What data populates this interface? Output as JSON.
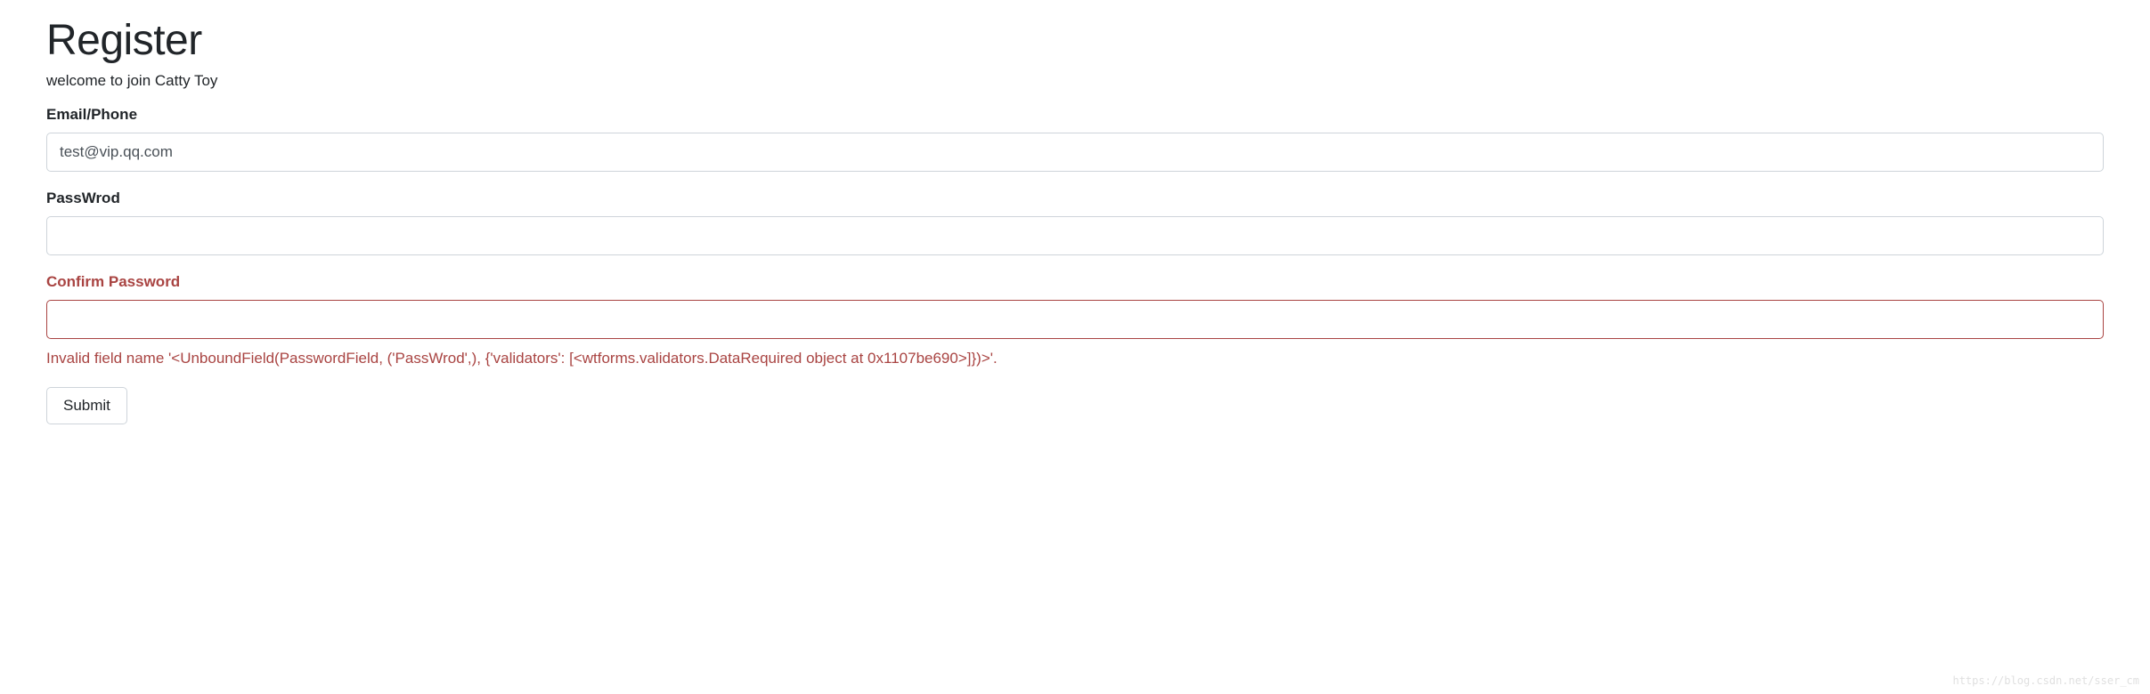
{
  "header": {
    "title": "Register",
    "subtitle": "welcome to join Catty Toy"
  },
  "form": {
    "email": {
      "label": "Email/Phone",
      "value": "test@vip.qq.com"
    },
    "password": {
      "label": "PassWrod",
      "value": ""
    },
    "confirm": {
      "label": "Confirm Password",
      "value": "",
      "error": "Invalid field name '<UnboundField(PasswordField, ('PassWrod',), {'validators': [<wtforms.validators.DataRequired object at 0x1107be690>]})>'."
    },
    "submit_label": "Submit"
  },
  "watermark": "https://blog.csdn.net/sser_cm"
}
